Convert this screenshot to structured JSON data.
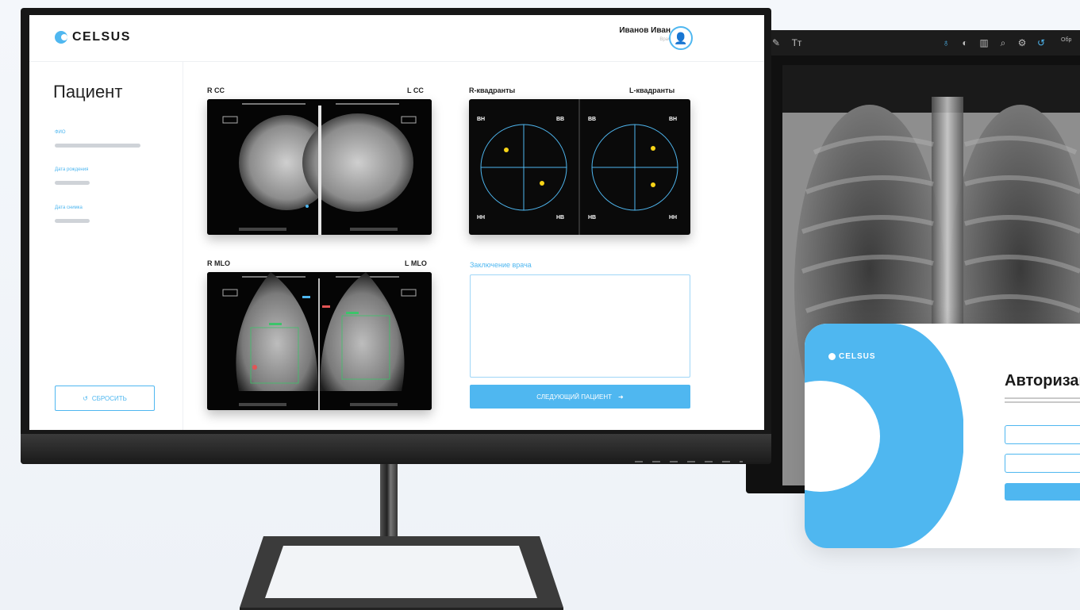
{
  "main_app": {
    "brand": "CELSUS",
    "user": {
      "name": "Иванов Иван",
      "role": "Врач"
    },
    "sidebar": {
      "title": "Пациент",
      "fields": [
        {
          "label": "ФИО"
        },
        {
          "label": "Дата рождения"
        },
        {
          "label": "Дата снимка"
        }
      ],
      "reset_label": "СБРОСИТЬ"
    },
    "views": {
      "cc_left": "R CC",
      "cc_right": "L CC",
      "mlo_left": "R MLO",
      "mlo_right": "L MLO"
    },
    "quadrants": {
      "left_title": "R-квадранты",
      "right_title": "L-квадранты",
      "labels_left": [
        "ВН",
        "ВВ",
        "НН",
        "НВ"
      ],
      "labels_right": [
        "ВВ",
        "ВН",
        "НВ",
        "НН"
      ]
    },
    "conclusion_label": "Заключение врача",
    "next_label": "СЛЕДУЮЩИЙ ПАЦИЕНТ"
  },
  "viewer": {
    "toolbar_label": "Обр"
  },
  "login": {
    "brand": "CELSUS",
    "title": "Авторизац"
  },
  "colors": {
    "accent": "#4fb7f0",
    "marker": "#f7d417"
  },
  "icons": [
    "user-icon",
    "reset-icon",
    "arrow-right-icon",
    "pen-icon",
    "text-icon",
    "zoom-icon",
    "contrast-icon"
  ]
}
